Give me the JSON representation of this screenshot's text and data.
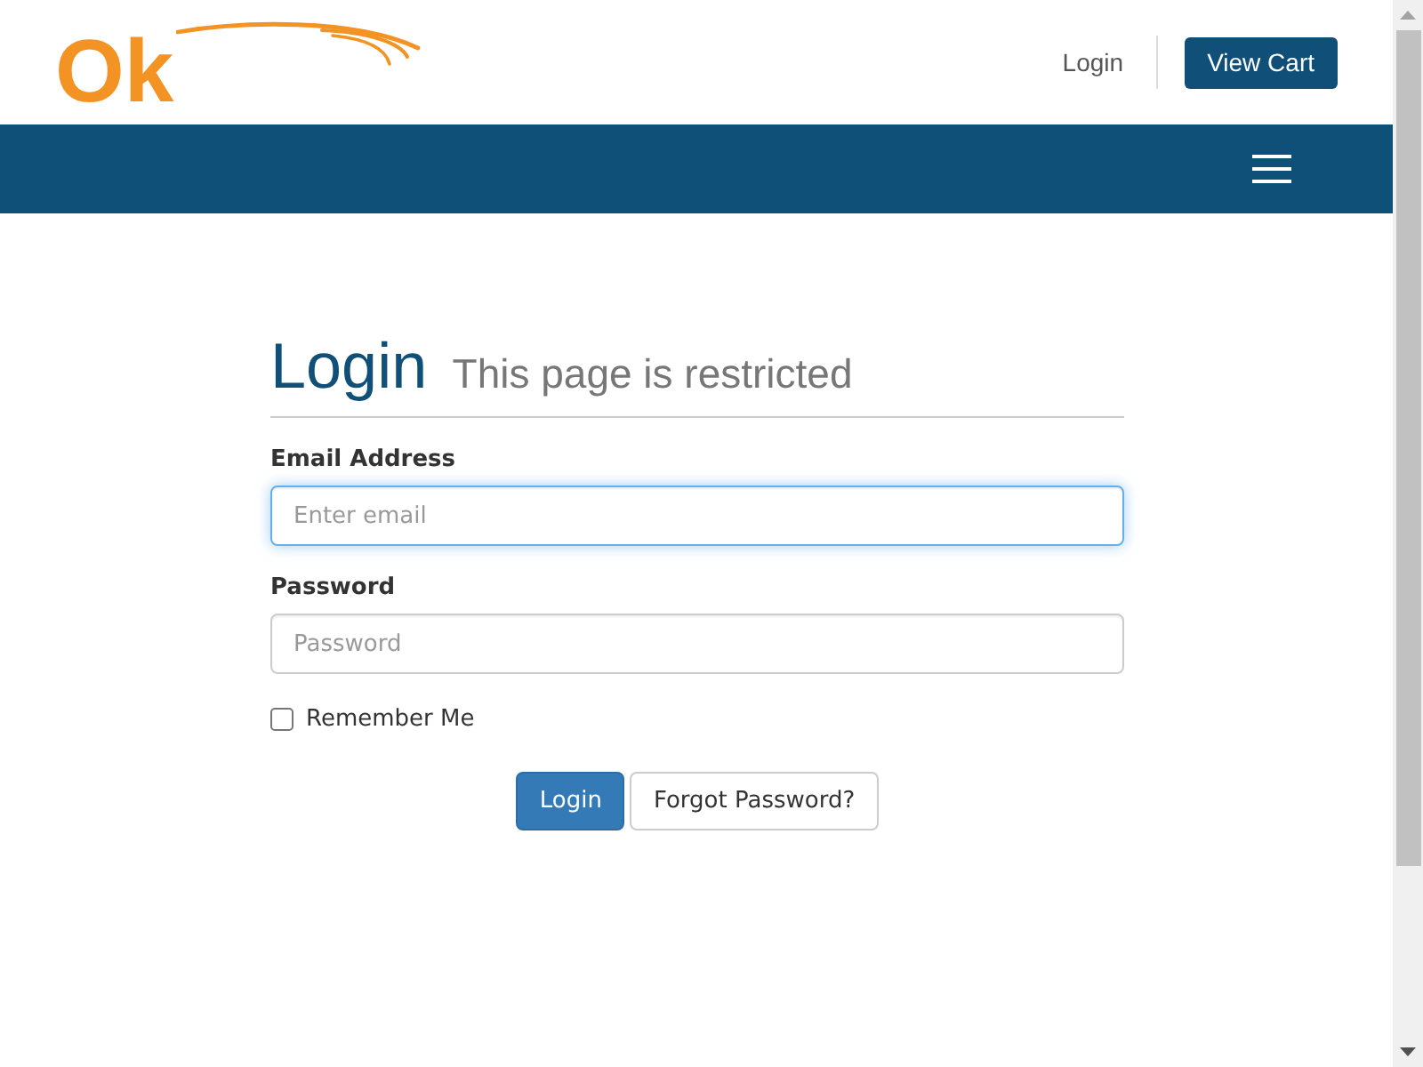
{
  "header": {
    "logo_text": "Ok",
    "links": [
      {
        "label": "Login"
      }
    ],
    "cart_button": "View Cart"
  },
  "form": {
    "title": "Login",
    "subtitle": "This page is restricted",
    "fields": [
      {
        "label": "Email Address",
        "placeholder": "Enter email",
        "focused": true
      },
      {
        "label": "Password",
        "placeholder": "Password",
        "focused": false
      }
    ],
    "remember": {
      "label": "Remember Me",
      "checked": false
    },
    "buttons": [
      {
        "kind": "primary",
        "label": "Login"
      },
      {
        "kind": "default",
        "label": "Forgot Password?"
      }
    ]
  }
}
